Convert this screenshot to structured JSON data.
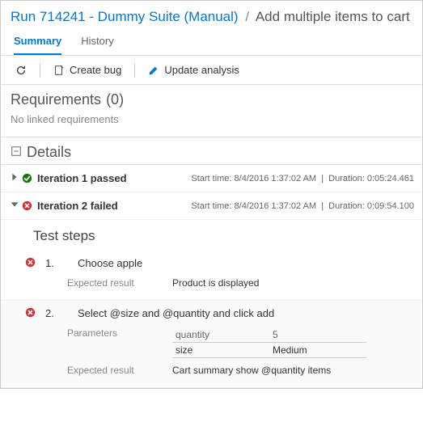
{
  "breadcrumb": {
    "run_link": "Run 714241 - Dummy Suite (Manual)",
    "separator": "/",
    "current": "Add multiple items to cart"
  },
  "tabs": {
    "summary": "Summary",
    "history": "History"
  },
  "toolbar": {
    "create_bug": "Create bug",
    "update_analysis": "Update analysis"
  },
  "requirements": {
    "header_prefix": "Requirements",
    "count": "(0)",
    "empty_msg": "No linked requirements"
  },
  "details": {
    "header": "Details"
  },
  "iterations": [
    {
      "status_text": "Iteration 1 passed",
      "outcome": "pass",
      "expanded": false,
      "start_prefix": "Start time:",
      "start_value": "8/4/2016 1:37:02 AM",
      "duration_prefix": "Duration:",
      "duration_value": "0:05:24.461"
    },
    {
      "status_text": "Iteration 2 failed",
      "outcome": "fail",
      "expanded": true,
      "start_prefix": "Start time:",
      "start_value": "8/4/2016 1:37:02 AM",
      "duration_prefix": "Duration:",
      "duration_value": "0:09:54.100"
    }
  ],
  "steps": {
    "header": "Test steps",
    "list": [
      {
        "num": "1.",
        "outcome": "fail",
        "action": "Choose apple",
        "expected_label": "Expected result",
        "expected_value": "Product is displayed"
      },
      {
        "num": "2.",
        "outcome": "fail",
        "action": "Select @size and @quantity and click add",
        "params_label": "Parameters",
        "params": {
          "h1": "quantity",
          "v1": "5",
          "h2": "size",
          "v2": "Medium"
        },
        "expected_label": "Expected result",
        "expected_value": "Cart summary show @quantity items"
      }
    ]
  }
}
